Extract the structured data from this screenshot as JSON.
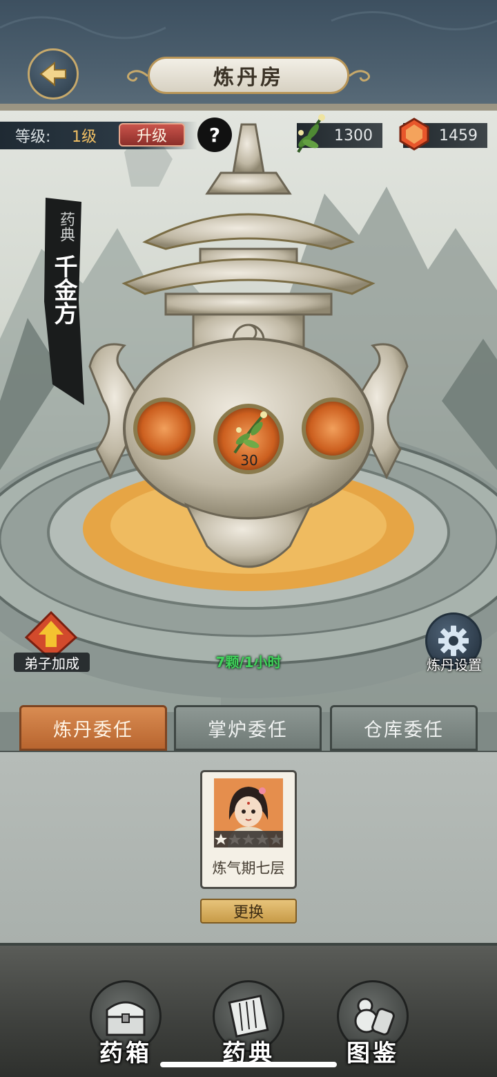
{
  "header": {
    "title": "炼丹房",
    "back_icon": "back-arrow-icon"
  },
  "stats": {
    "level_label": "等级:",
    "level_value": "1级",
    "upgrade_label": "升级",
    "help_label": "?",
    "herb_amount": "1300",
    "gem_amount": "1459"
  },
  "scroll": {
    "small_text": "药典",
    "main_text": "千金方"
  },
  "furnace": {
    "herb_count": "30",
    "rate_text": "7颗/1小时"
  },
  "side_buttons": {
    "bonus_label": "弟子加成",
    "settings_label": "炼丹设置"
  },
  "tabs": [
    {
      "label": "炼丹委任",
      "active": true
    },
    {
      "label": "掌炉委任",
      "active": false
    },
    {
      "label": "仓库委任",
      "active": false
    }
  ],
  "disciple": {
    "name": "炼气期七层",
    "stars_total": 5,
    "stars_filled": 1,
    "swap_label": "更换"
  },
  "bottom_nav": [
    {
      "label": "药箱",
      "icon": "chest-icon"
    },
    {
      "label": "药典",
      "icon": "scroll-book-icon"
    },
    {
      "label": "图鉴",
      "icon": "gourd-scroll-icon"
    }
  ],
  "colors": {
    "active_tab": "#c97440",
    "inactive_tab": "#7f8985",
    "upgrade_button": "#b0433c",
    "rate_text": "#41d35b"
  }
}
